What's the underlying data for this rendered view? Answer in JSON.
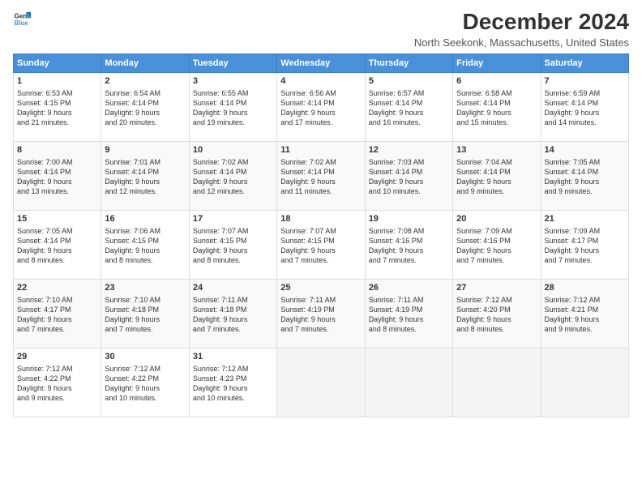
{
  "logo": {
    "line1": "General",
    "line2": "Blue"
  },
  "header": {
    "month_year": "December 2024",
    "location": "North Seekonk, Massachusetts, United States"
  },
  "days_of_week": [
    "Sunday",
    "Monday",
    "Tuesday",
    "Wednesday",
    "Thursday",
    "Friday",
    "Saturday"
  ],
  "weeks": [
    [
      {
        "day": "1",
        "sunrise": "6:53 AM",
        "sunset": "4:15 PM",
        "daylight": "9 hours and 21 minutes."
      },
      {
        "day": "2",
        "sunrise": "6:54 AM",
        "sunset": "4:14 PM",
        "daylight": "9 hours and 20 minutes."
      },
      {
        "day": "3",
        "sunrise": "6:55 AM",
        "sunset": "4:14 PM",
        "daylight": "9 hours and 19 minutes."
      },
      {
        "day": "4",
        "sunrise": "6:56 AM",
        "sunset": "4:14 PM",
        "daylight": "9 hours and 17 minutes."
      },
      {
        "day": "5",
        "sunrise": "6:57 AM",
        "sunset": "4:14 PM",
        "daylight": "9 hours and 16 minutes."
      },
      {
        "day": "6",
        "sunrise": "6:58 AM",
        "sunset": "4:14 PM",
        "daylight": "9 hours and 15 minutes."
      },
      {
        "day": "7",
        "sunrise": "6:59 AM",
        "sunset": "4:14 PM",
        "daylight": "9 hours and 14 minutes."
      }
    ],
    [
      {
        "day": "8",
        "sunrise": "7:00 AM",
        "sunset": "4:14 PM",
        "daylight": "9 hours and 13 minutes."
      },
      {
        "day": "9",
        "sunrise": "7:01 AM",
        "sunset": "4:14 PM",
        "daylight": "9 hours and 12 minutes."
      },
      {
        "day": "10",
        "sunrise": "7:02 AM",
        "sunset": "4:14 PM",
        "daylight": "9 hours and 12 minutes."
      },
      {
        "day": "11",
        "sunrise": "7:02 AM",
        "sunset": "4:14 PM",
        "daylight": "9 hours and 11 minutes."
      },
      {
        "day": "12",
        "sunrise": "7:03 AM",
        "sunset": "4:14 PM",
        "daylight": "9 hours and 10 minutes."
      },
      {
        "day": "13",
        "sunrise": "7:04 AM",
        "sunset": "4:14 PM",
        "daylight": "9 hours and 9 minutes."
      },
      {
        "day": "14",
        "sunrise": "7:05 AM",
        "sunset": "4:14 PM",
        "daylight": "9 hours and 9 minutes."
      }
    ],
    [
      {
        "day": "15",
        "sunrise": "7:05 AM",
        "sunset": "4:14 PM",
        "daylight": "9 hours and 8 minutes."
      },
      {
        "day": "16",
        "sunrise": "7:06 AM",
        "sunset": "4:15 PM",
        "daylight": "9 hours and 8 minutes."
      },
      {
        "day": "17",
        "sunrise": "7:07 AM",
        "sunset": "4:15 PM",
        "daylight": "9 hours and 8 minutes."
      },
      {
        "day": "18",
        "sunrise": "7:07 AM",
        "sunset": "4:15 PM",
        "daylight": "9 hours and 7 minutes."
      },
      {
        "day": "19",
        "sunrise": "7:08 AM",
        "sunset": "4:16 PM",
        "daylight": "9 hours and 7 minutes."
      },
      {
        "day": "20",
        "sunrise": "7:09 AM",
        "sunset": "4:16 PM",
        "daylight": "9 hours and 7 minutes."
      },
      {
        "day": "21",
        "sunrise": "7:09 AM",
        "sunset": "4:17 PM",
        "daylight": "9 hours and 7 minutes."
      }
    ],
    [
      {
        "day": "22",
        "sunrise": "7:10 AM",
        "sunset": "4:17 PM",
        "daylight": "9 hours and 7 minutes."
      },
      {
        "day": "23",
        "sunrise": "7:10 AM",
        "sunset": "4:18 PM",
        "daylight": "9 hours and 7 minutes."
      },
      {
        "day": "24",
        "sunrise": "7:11 AM",
        "sunset": "4:18 PM",
        "daylight": "9 hours and 7 minutes."
      },
      {
        "day": "25",
        "sunrise": "7:11 AM",
        "sunset": "4:19 PM",
        "daylight": "9 hours and 7 minutes."
      },
      {
        "day": "26",
        "sunrise": "7:11 AM",
        "sunset": "4:19 PM",
        "daylight": "9 hours and 8 minutes."
      },
      {
        "day": "27",
        "sunrise": "7:12 AM",
        "sunset": "4:20 PM",
        "daylight": "9 hours and 8 minutes."
      },
      {
        "day": "28",
        "sunrise": "7:12 AM",
        "sunset": "4:21 PM",
        "daylight": "9 hours and 9 minutes."
      }
    ],
    [
      {
        "day": "29",
        "sunrise": "7:12 AM",
        "sunset": "4:22 PM",
        "daylight": "9 hours and 9 minutes."
      },
      {
        "day": "30",
        "sunrise": "7:12 AM",
        "sunset": "4:22 PM",
        "daylight": "9 hours and 10 minutes."
      },
      {
        "day": "31",
        "sunrise": "7:12 AM",
        "sunset": "4:23 PM",
        "daylight": "9 hours and 10 minutes."
      },
      null,
      null,
      null,
      null
    ]
  ]
}
